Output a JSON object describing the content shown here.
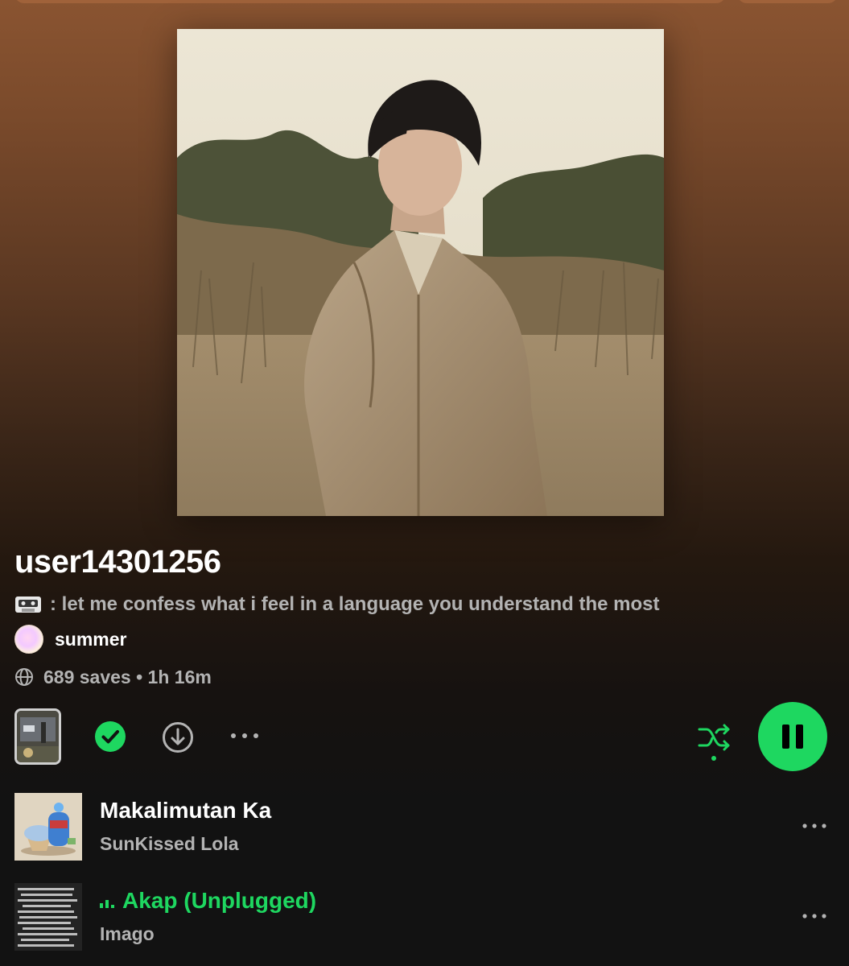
{
  "playlist": {
    "title": "user14301256",
    "description": ": let me confess what i feel in a language you understand the most",
    "owner": "summer",
    "meta": "689 saves • 1h 16m"
  },
  "icons": {
    "description_prefix": "cassette-icon",
    "meta_prefix": "globe-icon",
    "saved": "check-circle-icon",
    "download": "download-icon",
    "more": "more-horizontal-icon",
    "shuffle": "shuffle-icon",
    "play_pause": "pause-icon"
  },
  "colors": {
    "accent": "#1ed760",
    "header_gradient_top": "#8a5431",
    "background": "#121212",
    "secondary_text": "#b3b3b3"
  },
  "tracks": [
    {
      "title": "Makalimutan Ka",
      "artist": "SunKissed Lola",
      "playing": false
    },
    {
      "title": "Akap (Unplugged)",
      "artist": "Imago",
      "playing": true
    }
  ]
}
